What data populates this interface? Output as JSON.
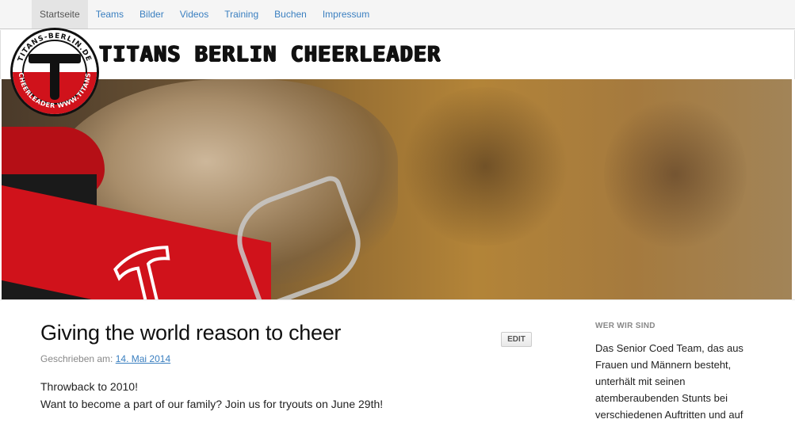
{
  "nav": {
    "items": [
      {
        "label": "Startseite",
        "active": true
      },
      {
        "label": "Teams",
        "active": false
      },
      {
        "label": "Bilder",
        "active": false
      },
      {
        "label": "Videos",
        "active": false
      },
      {
        "label": "Training",
        "active": false
      },
      {
        "label": "Buchen",
        "active": false
      },
      {
        "label": "Impressum",
        "active": false
      }
    ]
  },
  "header": {
    "site_title": "TITANS BERLIN CHEERLEADER",
    "logo_ring_top": "TITANS-BERLIN.DE",
    "logo_ring_bottom": "CHEERLEADER  WWW.TITANS",
    "logo_icon": "titans-t-icon"
  },
  "post": {
    "title": "Giving the world reason to cheer",
    "edit_label": "EDIT",
    "meta_prefix": "Geschrieben am:",
    "date": "14. Mai 2014",
    "lines": [
      "Throwback to 2010!",
      "Want to become a part of our family? Join us for tryouts on June 29th!"
    ]
  },
  "sidebar": {
    "widget_title": "WER WIR SIND",
    "widget_text": "Das Senior Coed Team, das aus Frauen und Männern besteht, unterhält mit seinen atemberaubenden Stunts bei verschiedenen Auftritten und auf"
  },
  "colors": {
    "link": "#3a7fc0",
    "brand_red": "#d0121b",
    "nav_bg": "#f5f5f5"
  }
}
